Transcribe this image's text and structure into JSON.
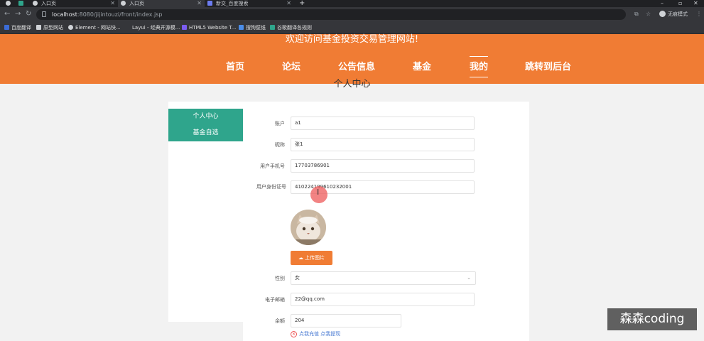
{
  "browser": {
    "tabs": [
      {
        "label": "",
        "active": false
      },
      {
        "label": "",
        "active": false
      },
      {
        "label": "入口页",
        "active": false
      },
      {
        "label": "入口页",
        "active": true
      },
      {
        "label": "新交_百度搜索",
        "active": false
      }
    ],
    "url_host": "localhost",
    "url_path": ":8080/jijintouzi/front/index.jsp",
    "incognito_label": "无痕模式",
    "bookmarks": [
      "百度翻译",
      "原型网站",
      "Element - 网站快...",
      "Layui - 经典开源模...",
      "HTML5 Website T...",
      "搜狗壁纸",
      "谷歌翻译各规则"
    ]
  },
  "header": {
    "welcome": "欢迎访问基金投资交易管理网站!",
    "nav": [
      {
        "label": "首页",
        "active": false
      },
      {
        "label": "论坛",
        "active": false
      },
      {
        "label": "公告信息",
        "active": false
      },
      {
        "label": "基金",
        "active": false
      },
      {
        "label": "我的",
        "active": true
      },
      {
        "label": "跳转到后台",
        "active": false
      }
    ]
  },
  "page_heading": "个人中心",
  "sidemenu": [
    {
      "label": "个人中心"
    },
    {
      "label": "基金自选"
    }
  ],
  "form": {
    "account_label": "账户",
    "account_value": "a1",
    "nickname_label": "昵称",
    "nickname_value": "张1",
    "phone_label": "用户手机号",
    "phone_value": "17703786901",
    "idcard_label": "用户身份证号",
    "idcard_value": "410224199610232001",
    "upload_label": "上传图片",
    "gender_label": "性别",
    "gender_value": "女",
    "email_label": "电子邮箱",
    "email_value": "22@qq.com",
    "balance_label": "余额",
    "balance_value": "204",
    "balance_links": "点我充值 点我提现"
  },
  "watermark": "森森coding"
}
